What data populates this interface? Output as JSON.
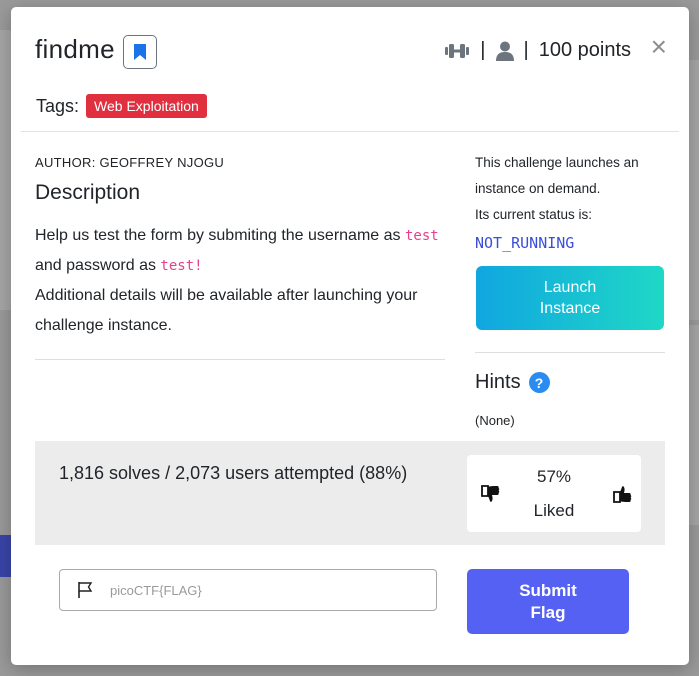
{
  "modal": {
    "title": "findme",
    "points": "100 points",
    "separator": "|",
    "close_glyph": "×",
    "tags_label": "Tags:",
    "tags": [
      "Web Exploitation"
    ]
  },
  "main": {
    "author": "AUTHOR: GEOFFREY NJOGU",
    "description_title": "Description",
    "description_part1": "Help us test the form by submiting the username as",
    "username_code": "test",
    "description_part2": "and password as",
    "password_code": "test!",
    "description_part3": "Additional details will be available after launching your challenge instance."
  },
  "sidebar": {
    "instance_line1": "This challenge launches an instance on demand.",
    "instance_line2": "Its current status is:",
    "status": "NOT_RUNNING",
    "launch_label": "Launch Instance",
    "hints_title": "Hints",
    "hints_icon": "?",
    "hints_value": "(None)"
  },
  "stats": {
    "solves_text": "1,816 solves / 2,073 users attempted (88%)",
    "liked_percent": "57%",
    "liked_label": "Liked"
  },
  "flag": {
    "placeholder": "picoCTF{FLAG}",
    "submit_label": "Submit Flag"
  },
  "icons": {
    "difficulty": "dumbbell-icon",
    "user": "user-icon",
    "bookmark": "bookmark-icon",
    "thumb_down": "thumbs-down-icon",
    "thumb_up": "thumbs-up-icon",
    "flag": "flag-icon"
  },
  "colors": {
    "tag_bg": "#e0303f",
    "status_text": "#3a4fd8",
    "launch_gradient_start": "#10a6e0",
    "launch_gradient_end": "#1fd8c6",
    "submit_bg": "#5561f2",
    "bookmark_blue": "#1a73e8",
    "hint_blue": "#2a8cf0"
  }
}
